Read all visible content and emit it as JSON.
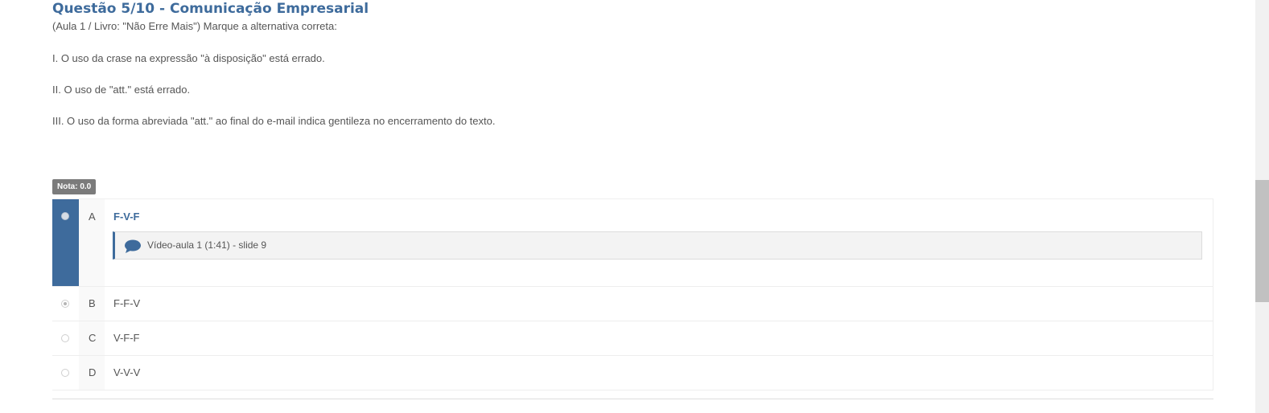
{
  "question": {
    "title": "Questão 5/10 - Comunicação Empresarial",
    "intro": "(Aula 1 / Livro: \"Não Erre Mais\") Marque a alternativa correta:",
    "statements": [
      "I. O uso da crase na expressão \"à disposição\" está errado.",
      "II. O uso de \"att.\" está errado.",
      "III. O uso da forma abreviada \"att.\" ao final do e-mail indica gentileza no encerramento do texto."
    ]
  },
  "grade": {
    "label": "Nota: 0.0"
  },
  "options": [
    {
      "letter": "A",
      "text": "F-V-F",
      "selected": true,
      "checked": false,
      "feedback": "Vídeo-aula 1 (1:41) - slide 9"
    },
    {
      "letter": "B",
      "text": "F-F-V",
      "selected": false,
      "checked": true
    },
    {
      "letter": "C",
      "text": "V-F-F",
      "selected": false,
      "checked": false
    },
    {
      "letter": "D",
      "text": "V-V-V",
      "selected": false,
      "checked": false
    }
  ],
  "colors": {
    "accent": "#3e6b9c",
    "grade_badge": "#7b7b7b"
  },
  "icons": {
    "feedback": "comment-icon"
  }
}
